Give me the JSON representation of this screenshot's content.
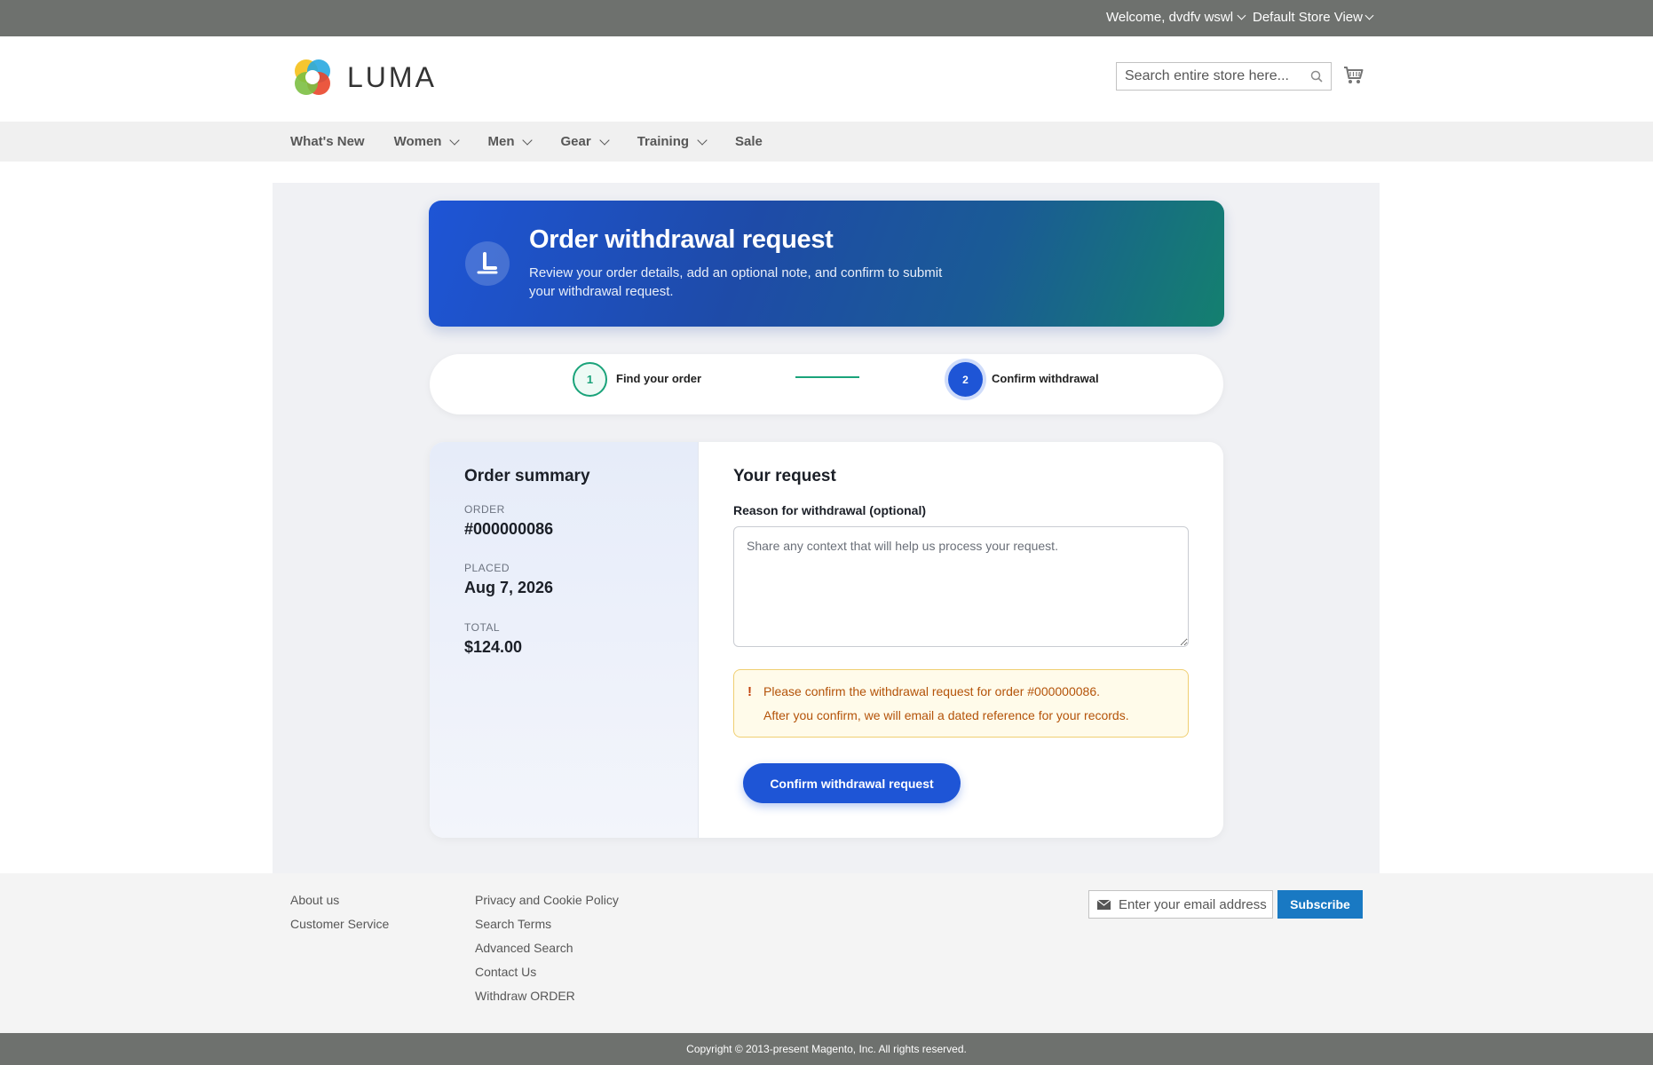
{
  "topbar": {
    "welcome": "Welcome, dvdfv wswl",
    "store_view": "Default Store View"
  },
  "header": {
    "logo_text": "LUMA",
    "search_placeholder": "Search entire store here..."
  },
  "nav": {
    "items": [
      {
        "label": "What's New",
        "dropdown": false
      },
      {
        "label": "Women",
        "dropdown": true
      },
      {
        "label": "Men",
        "dropdown": true
      },
      {
        "label": "Gear",
        "dropdown": true
      },
      {
        "label": "Training",
        "dropdown": true
      },
      {
        "label": "Sale",
        "dropdown": false
      }
    ]
  },
  "hero": {
    "title": "Order withdrawal request",
    "subtitle": "Review your order details, add an optional note, and confirm to submit your withdrawal request."
  },
  "stepper": {
    "step1": {
      "number": "1",
      "label": "Find your order"
    },
    "step2": {
      "number": "2",
      "label": "Confirm withdrawal"
    }
  },
  "summary": {
    "title": "Order summary",
    "order_label": "ORDER",
    "order_value": "#000000086",
    "placed_label": "PLACED",
    "placed_value": "Aug 7, 2026",
    "total_label": "TOTAL",
    "total_value": "$124.00"
  },
  "request": {
    "title": "Your request",
    "reason_label": "Reason for withdrawal (optional)",
    "reason_placeholder": "Share any context that will help us process your request.",
    "reason_value": "",
    "alert_icon": "!",
    "alert_line1": "Please confirm the withdrawal request for order #000000086.",
    "alert_line2": "After you confirm, we will email a dated reference for your records.",
    "confirm_label": "Confirm withdrawal request"
  },
  "footer": {
    "col1": [
      "About us",
      "Customer Service"
    ],
    "col2": [
      "Privacy and Cookie Policy",
      "Search Terms",
      "Advanced Search",
      "Contact Us",
      "Withdraw ORDER"
    ],
    "newsletter_placeholder": "Enter your email address",
    "subscribe_label": "Subscribe",
    "copyright": "Copyright © 2013-present Magento, Inc. All rights reserved."
  },
  "colors": {
    "accent_blue": "#1e55d6",
    "step_done_green": "#1aa37a",
    "subscribe_blue": "#1979c3",
    "alert_text": "#b45309"
  }
}
